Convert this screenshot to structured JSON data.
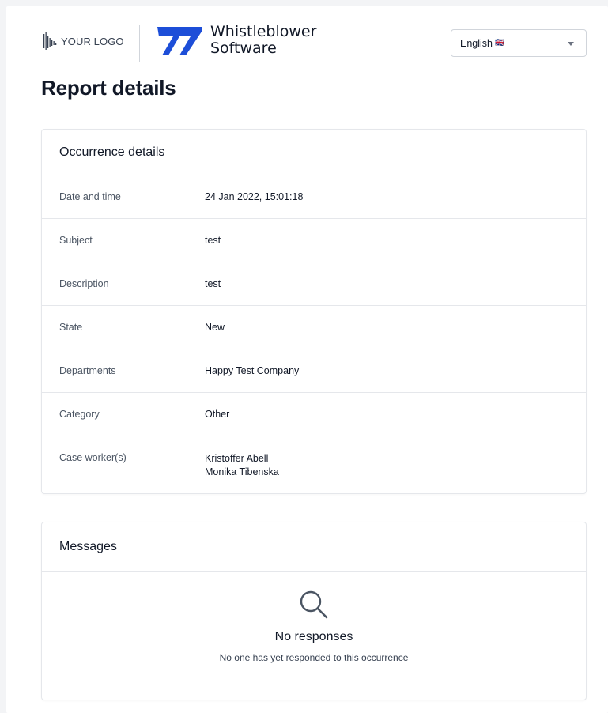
{
  "header": {
    "your_logo_text": "YOUR LOGO",
    "brand_line1": "Whistleblower",
    "brand_line2": "Software",
    "brand_color": "#1d4ed8",
    "language": {
      "selected": "English",
      "flag": "🇬🇧"
    }
  },
  "page_title": "Report details",
  "occurrence": {
    "title": "Occurrence details",
    "rows": [
      {
        "label": "Date and time",
        "values": [
          "24 Jan 2022, 15:01:18"
        ]
      },
      {
        "label": "Subject",
        "values": [
          "test"
        ]
      },
      {
        "label": "Description",
        "values": [
          "test"
        ]
      },
      {
        "label": "State",
        "values": [
          "New"
        ]
      },
      {
        "label": "Departments",
        "values": [
          "Happy Test Company"
        ]
      },
      {
        "label": "Category",
        "values": [
          "Other"
        ]
      },
      {
        "label": "Case worker(s)",
        "values": [
          "Kristoffer Abell",
          "Monika Tibenska"
        ]
      }
    ]
  },
  "messages": {
    "title": "Messages",
    "empty_icon": "search-icon",
    "empty_title": "No responses",
    "empty_subtitle": "No one has yet responded to this occurrence"
  }
}
